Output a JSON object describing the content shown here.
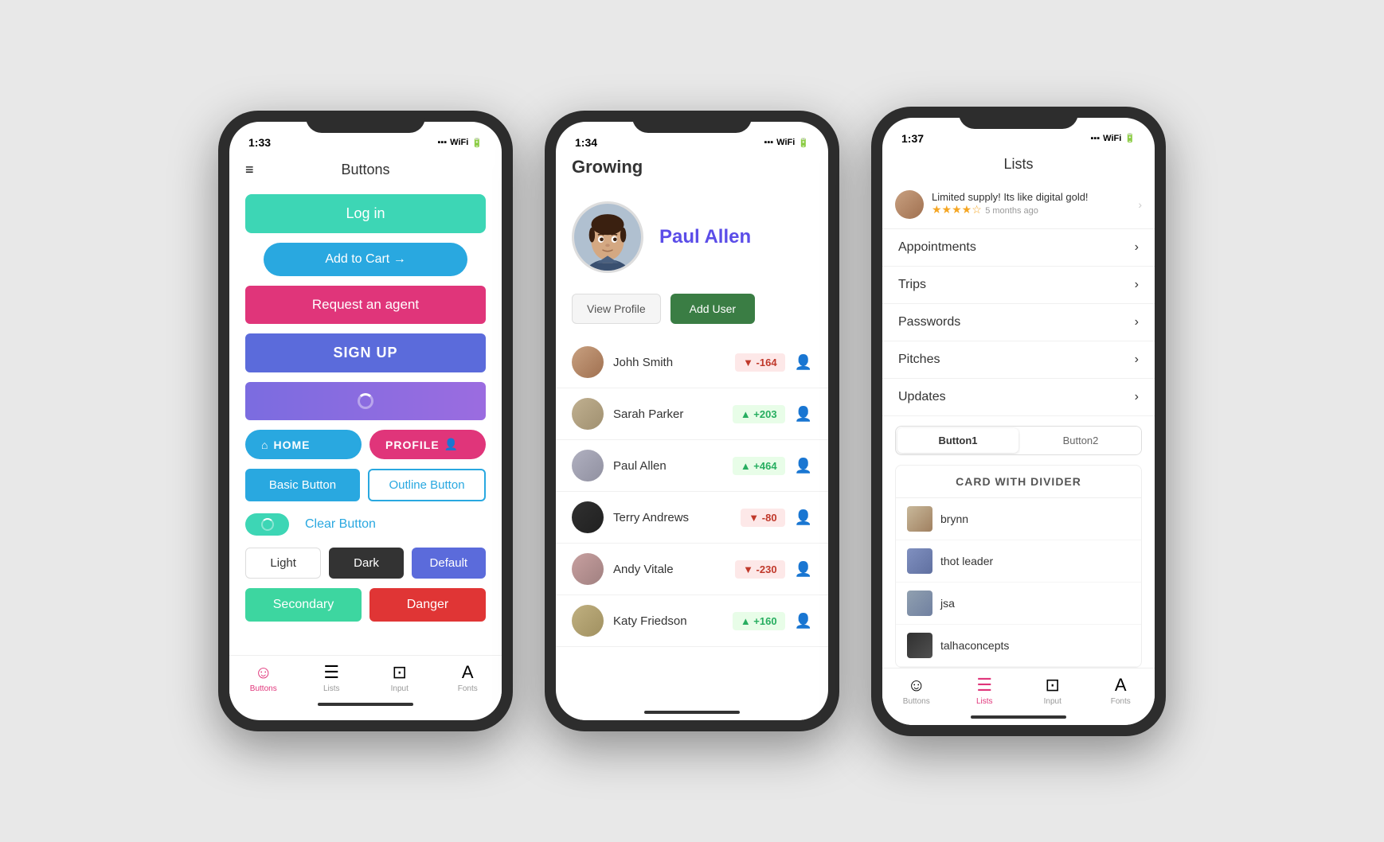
{
  "background": "#e8e8e8",
  "phones": [
    {
      "id": "phone1",
      "time": "1:33",
      "title": "Buttons",
      "buttons": {
        "login": "Log in",
        "addCart": "Add to Cart →",
        "agent": "Request an agent",
        "signup": "SIGN UP",
        "home": "HOME",
        "profile": "PROFILE",
        "basic": "Basic Button",
        "outline": "Outline Button",
        "clear": "Clear Button",
        "light": "Light",
        "dark": "Dark",
        "default": "Default",
        "secondary": "Secondary",
        "danger": "Danger"
      },
      "tabs": [
        {
          "label": "Buttons",
          "active": true
        },
        {
          "label": "Lists",
          "active": false
        },
        {
          "label": "Input",
          "active": false
        },
        {
          "label": "Fonts",
          "active": false
        }
      ]
    },
    {
      "id": "phone2",
      "time": "1:34",
      "appName": "Growing",
      "profileName": "Paul Allen",
      "viewProfile": "View Profile",
      "addUser": "Add User",
      "users": [
        {
          "name": "Johh Smith",
          "score": -164,
          "positive": false
        },
        {
          "name": "Sarah Parker",
          "score": 203,
          "positive": true
        },
        {
          "name": "Paul Allen",
          "score": 464,
          "positive": true
        },
        {
          "name": "Terry Andrews",
          "score": -80,
          "positive": false
        },
        {
          "name": "Andy Vitale",
          "score": -230,
          "positive": false
        },
        {
          "name": "Katy Friedson",
          "score": 160,
          "positive": true
        }
      ]
    },
    {
      "id": "phone3",
      "time": "1:37",
      "title": "Lists",
      "review": {
        "text": "Limited supply! Its like digital gold!",
        "time": "5 months ago",
        "stars": 4
      },
      "menuItems": [
        "Appointments",
        "Trips",
        "Passwords",
        "Pitches",
        "Updates"
      ],
      "tabs": [
        "Button1",
        "Button2"
      ],
      "cardTitle": "CARD WITH DIVIDER",
      "cardItems": [
        "brynn",
        "thot leader",
        "jsa",
        "talhaconcepts"
      ],
      "bottomTabs": [
        {
          "label": "Buttons",
          "active": false
        },
        {
          "label": "Lists",
          "active": true
        },
        {
          "label": "Input",
          "active": false
        },
        {
          "label": "Fonts",
          "active": false
        }
      ]
    }
  ]
}
